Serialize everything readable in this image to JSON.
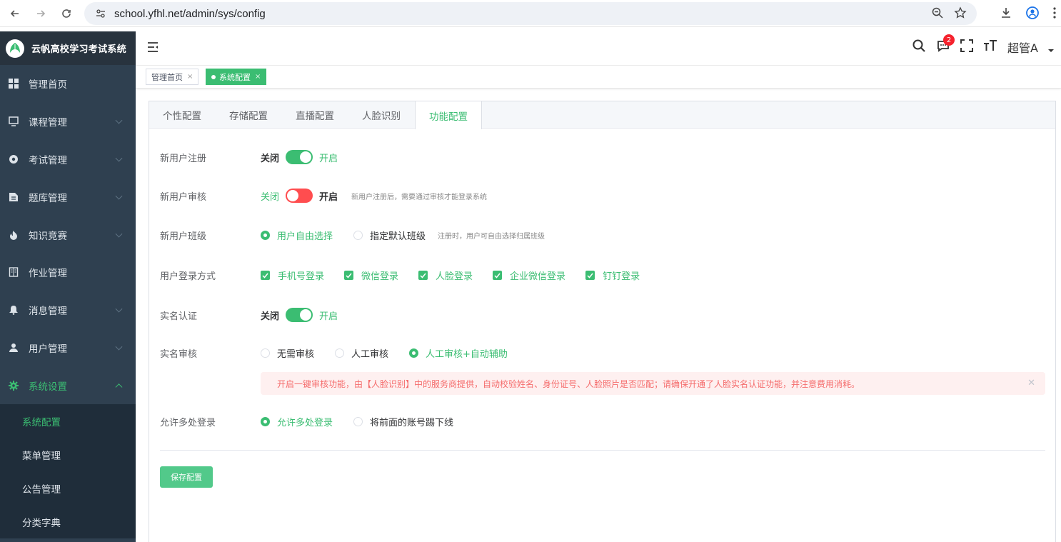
{
  "browser": {
    "url": "school.yfhl.net/admin/sys/config"
  },
  "app": {
    "title": "云帆高校学习考试系统",
    "user": "超管A",
    "notification_count": "2"
  },
  "sidebar": {
    "items": [
      {
        "label": "管理首页",
        "icon": "dashboard-icon"
      },
      {
        "label": "课程管理",
        "icon": "monitor-icon"
      },
      {
        "label": "考试管理",
        "icon": "target-icon"
      },
      {
        "label": "题库管理",
        "icon": "file-icon"
      },
      {
        "label": "知识竞赛",
        "icon": "fire-icon"
      },
      {
        "label": "作业管理",
        "icon": "book-icon"
      },
      {
        "label": "消息管理",
        "icon": "bell-icon"
      },
      {
        "label": "用户管理",
        "icon": "user-icon"
      },
      {
        "label": "系统设置",
        "icon": "gear-icon"
      }
    ],
    "subitems": [
      "系统配置",
      "菜单管理",
      "公告管理",
      "分类字典"
    ]
  },
  "tags": [
    {
      "label": "管理首页",
      "close": "×"
    },
    {
      "label": "系统配置",
      "close": "×"
    }
  ],
  "tabs": [
    "个性配置",
    "存储配置",
    "直播配置",
    "人脸识别",
    "功能配置"
  ],
  "form": {
    "register": {
      "label": "新用户注册",
      "off": "关闭",
      "on": "开启",
      "state": "on"
    },
    "audit": {
      "label": "新用户审核",
      "off": "关闭",
      "on": "开启",
      "state": "off",
      "hint": "新用户注册后，需要通过审核才能登录系统"
    },
    "class": {
      "label": "新用户班级",
      "options": [
        "用户自由选择",
        "指定默认班级"
      ],
      "selected": 0,
      "hint": "注册时，用户可自由选择归属班级"
    },
    "login": {
      "label": "用户登录方式",
      "options": [
        "手机号登录",
        "微信登录",
        "人脸登录",
        "企业微信登录",
        "钉钉登录"
      ]
    },
    "realname": {
      "label": "实名认证",
      "off": "关闭",
      "on": "开启",
      "state": "on"
    },
    "realname_audit": {
      "label": "实名审核",
      "options": [
        "无需审核",
        "人工审核",
        "人工审核+自动辅助"
      ],
      "selected": 2
    },
    "alert": "开启一键审核功能，由【人脸识别】中的服务商提供，自动校验姓名、身份证号、人脸照片是否匹配；请确保开通了人脸实名认证功能，并注意费用消耗。",
    "multi_login": {
      "label": "允许多处登录",
      "options": [
        "允许多处登录",
        "将前面的账号踢下线"
      ],
      "selected": 0
    },
    "save": "保存配置"
  },
  "colors": {
    "accent": "#3bbd72",
    "sidebar": "#2f4050",
    "danger": "#ff4d4f"
  }
}
